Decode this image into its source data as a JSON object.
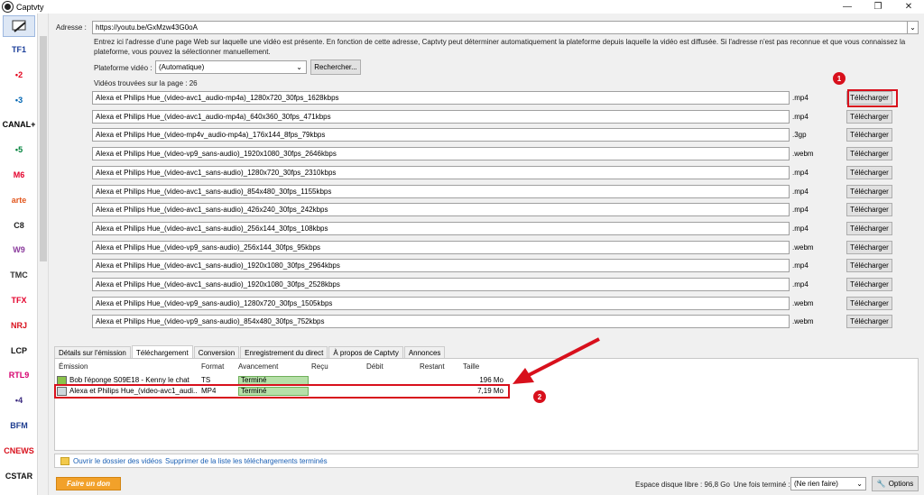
{
  "window": {
    "title": "Captvty",
    "minimize": "—",
    "maximize": "❐",
    "close": "✕"
  },
  "sidebar": {
    "channels": [
      {
        "label": "TF1",
        "color": "#1b3e9a"
      },
      {
        "label": "•2",
        "color": "#e3001b"
      },
      {
        "label": "•3",
        "color": "#0066b3"
      },
      {
        "label": "CANAL+",
        "color": "#000000"
      },
      {
        "label": "•5",
        "color": "#00833c"
      },
      {
        "label": "M6",
        "color": "#e4002b"
      },
      {
        "label": "arte",
        "color": "#e2571e"
      },
      {
        "label": "C8",
        "color": "#222222"
      },
      {
        "label": "W9",
        "color": "#8a3a9c"
      },
      {
        "label": "TMC",
        "color": "#333333"
      },
      {
        "label": "TFX",
        "color": "#e4002b"
      },
      {
        "label": "NRJ",
        "color": "#d8101c"
      },
      {
        "label": "LCP",
        "color": "#111111"
      },
      {
        "label": "RTL9",
        "color": "#d6006e"
      },
      {
        "label": "•4",
        "color": "#3b2a7f"
      },
      {
        "label": "BFM",
        "color": "#1d3c8f"
      },
      {
        "label": "CNEWS",
        "color": "#d8101c"
      },
      {
        "label": "CSTAR",
        "color": "#111111"
      }
    ]
  },
  "address": {
    "label": "Adresse :",
    "value": "https://youtu.be/GxMzw43G0oA",
    "help": "Entrez ici l'adresse d'une page Web sur laquelle une vidéo est présente. En fonction de cette adresse, Captvty peut déterminer automatiquement la plateforme depuis laquelle la vidéo est diffusée. Si l'adresse n'est pas reconnue et que vous connaissez la plateforme, vous pouvez la sélectionner manuellement."
  },
  "platform": {
    "label": "Plateforme vidéo :",
    "value": "(Automatique)",
    "search_button": "Rechercher..."
  },
  "found_label": "Vidéos trouvées sur la page : 26",
  "videos": [
    {
      "name": "Alexa et Philips Hue_(video-avc1_audio-mp4a)_1280x720_30fps_1628kbps",
      "ext": ".mp4",
      "button": "Télécharger"
    },
    {
      "name": "Alexa et Philips Hue_(video-avc1_audio-mp4a)_640x360_30fps_471kbps",
      "ext": ".mp4",
      "button": "Télécharger"
    },
    {
      "name": "Alexa et Philips Hue_(video-mp4v_audio-mp4a)_176x144_8fps_79kbps",
      "ext": ".3gp",
      "button": "Télécharger"
    },
    {
      "name": "Alexa et Philips Hue_(video-vp9_sans-audio)_1920x1080_30fps_2646kbps",
      "ext": ".webm",
      "button": "Télécharger"
    },
    {
      "name": "Alexa et Philips Hue_(video-avc1_sans-audio)_1280x720_30fps_2310kbps",
      "ext": ".mp4",
      "button": "Télécharger"
    },
    {
      "name": "Alexa et Philips Hue_(video-avc1_sans-audio)_854x480_30fps_1155kbps",
      "ext": ".mp4",
      "button": "Télécharger"
    },
    {
      "name": "Alexa et Philips Hue_(video-avc1_sans-audio)_426x240_30fps_242kbps",
      "ext": ".mp4",
      "button": "Télécharger"
    },
    {
      "name": "Alexa et Philips Hue_(video-avc1_sans-audio)_256x144_30fps_108kbps",
      "ext": ".mp4",
      "button": "Télécharger"
    },
    {
      "name": "Alexa et Philips Hue_(video-vp9_sans-audio)_256x144_30fps_95kbps",
      "ext": ".webm",
      "button": "Télécharger"
    },
    {
      "name": "Alexa et Philips Hue_(video-avc1_sans-audio)_1920x1080_30fps_2964kbps",
      "ext": ".mp4",
      "button": "Télécharger"
    },
    {
      "name": "Alexa et Philips Hue_(video-avc1_sans-audio)_1920x1080_30fps_2528kbps",
      "ext": ".mp4",
      "button": "Télécharger"
    },
    {
      "name": "Alexa et Philips Hue_(video-vp9_sans-audio)_1280x720_30fps_1505kbps",
      "ext": ".webm",
      "button": "Télécharger"
    },
    {
      "name": "Alexa et Philips Hue_(video-vp9_sans-audio)_854x480_30fps_752kbps",
      "ext": ".webm",
      "button": "Télécharger"
    }
  ],
  "tabs": [
    "Détails sur l'émission",
    "Téléchargement",
    "Conversion",
    "Enregistrement du direct",
    "À propos de Captvty",
    "Annonces"
  ],
  "active_tab": 1,
  "downloads": {
    "columns": [
      "Émission",
      "Format",
      "Avancement",
      "Reçu",
      "Débit",
      "Restant",
      "Taille"
    ],
    "rows": [
      {
        "emission": "Bob l'éponge S09E18 - Kenny le chat",
        "format": "TS",
        "status": "Terminé",
        "progress": 1.0,
        "size": "196 Mo"
      },
      {
        "emission": "Alexa et Philips Hue_(video-avc1_audi...",
        "format": "MP4",
        "status": "Terminé",
        "progress": 1.0,
        "size": "7,19 Mo"
      }
    ]
  },
  "links": {
    "open_folder": "Ouvrir le dossier des vidéos",
    "clear_list": "Supprimer de la liste les téléchargements terminés"
  },
  "footer": {
    "donate": "Faire un don",
    "disk_space": "Espace disque libre : 96,8 Go",
    "when_done_label": "Une fois terminé :",
    "when_done_value": "(Ne rien faire)",
    "options": "Options"
  },
  "annotations": {
    "badge1": "1",
    "badge2": "2",
    "color": "#d8101c"
  }
}
